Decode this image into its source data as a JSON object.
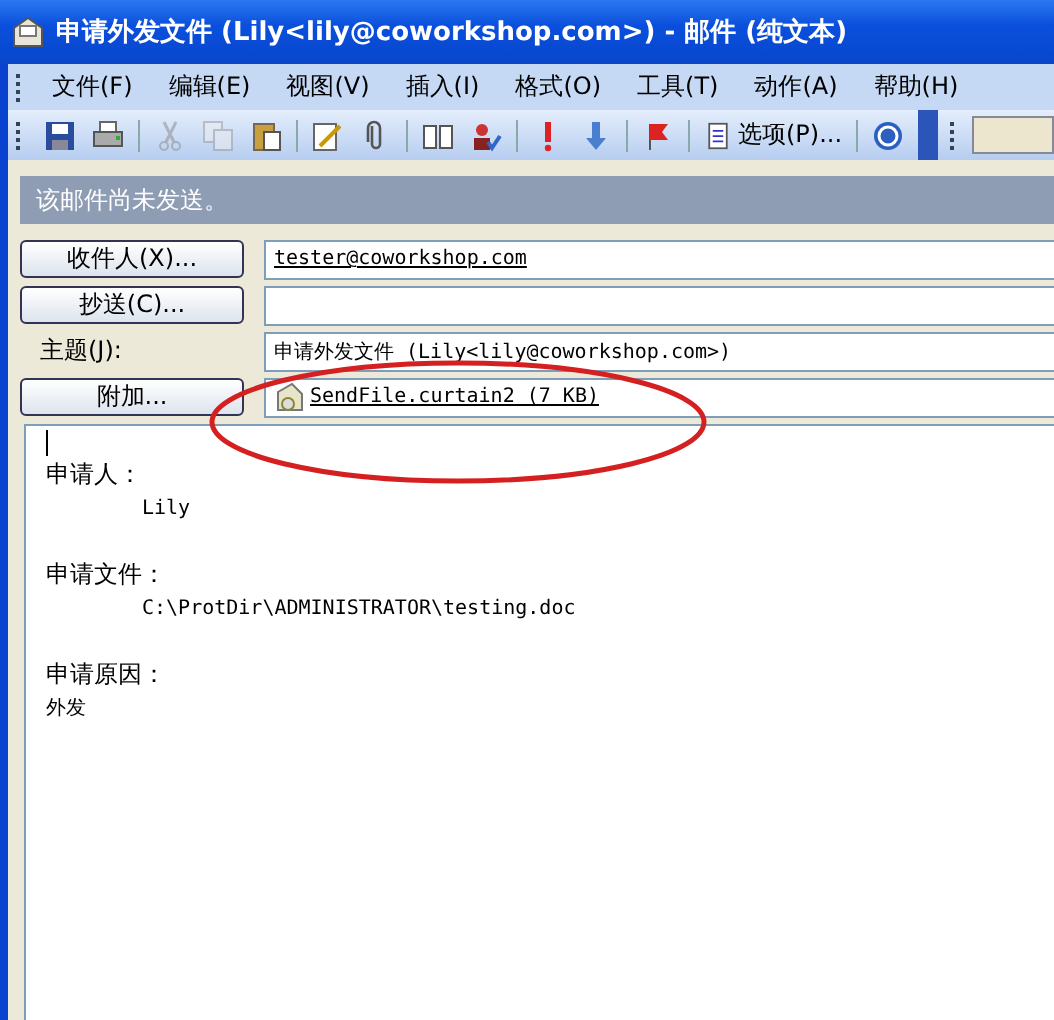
{
  "window": {
    "title": "申请外发文件 (Lily<lily@coworkshop.com>) - 邮件 (纯文本)"
  },
  "menu": [
    "文件(F)",
    "编辑(E)",
    "视图(V)",
    "插入(I)",
    "格式(O)",
    "工具(T)",
    "动作(A)",
    "帮助(H)"
  ],
  "toolbar": [
    {
      "kind": "save",
      "disabled": false
    },
    {
      "kind": "print",
      "disabled": false
    },
    {
      "kind": "sep"
    },
    {
      "kind": "cut",
      "disabled": true
    },
    {
      "kind": "copy",
      "disabled": true
    },
    {
      "kind": "paste",
      "disabled": false
    },
    {
      "kind": "sep"
    },
    {
      "kind": "signature",
      "disabled": false
    },
    {
      "kind": "attach",
      "disabled": false
    },
    {
      "kind": "sep"
    },
    {
      "kind": "book",
      "disabled": false
    },
    {
      "kind": "checknames",
      "disabled": false
    },
    {
      "kind": "sep"
    },
    {
      "kind": "high",
      "disabled": false
    },
    {
      "kind": "low",
      "disabled": false
    },
    {
      "kind": "sep"
    },
    {
      "kind": "flag",
      "disabled": false
    },
    {
      "kind": "sep"
    },
    {
      "kind": "options",
      "label": "选项(P)...",
      "disabled": false
    },
    {
      "kind": "sep"
    },
    {
      "kind": "help",
      "disabled": false
    }
  ],
  "info_bar": "该邮件尚未发送。",
  "fields": [
    {
      "kind": "button",
      "label": "收件人(X)...",
      "value": "tester@coworkshop.com",
      "underlined": true
    },
    {
      "kind": "button",
      "label": "抄送(C)..."
    },
    {
      "kind": "label",
      "label": "主题(J):",
      "value": "申请外发文件 (Lily<lily@coworkshop.com>)",
      "underlined": false
    },
    {
      "kind": "attachment",
      "label": "附加...",
      "value": "SendFile.curtain2 (7 KB)",
      "underlined": true
    }
  ],
  "body": [
    {
      "label": "申请人：",
      "value": "Lily",
      "indented": true
    },
    {
      "label": "申请文件：",
      "value": "C:\\ProtDir\\ADMINISTRATOR\\testing.doc",
      "indented": true
    },
    {
      "label": "申请原因：",
      "value": "外发",
      "indented": false
    }
  ]
}
